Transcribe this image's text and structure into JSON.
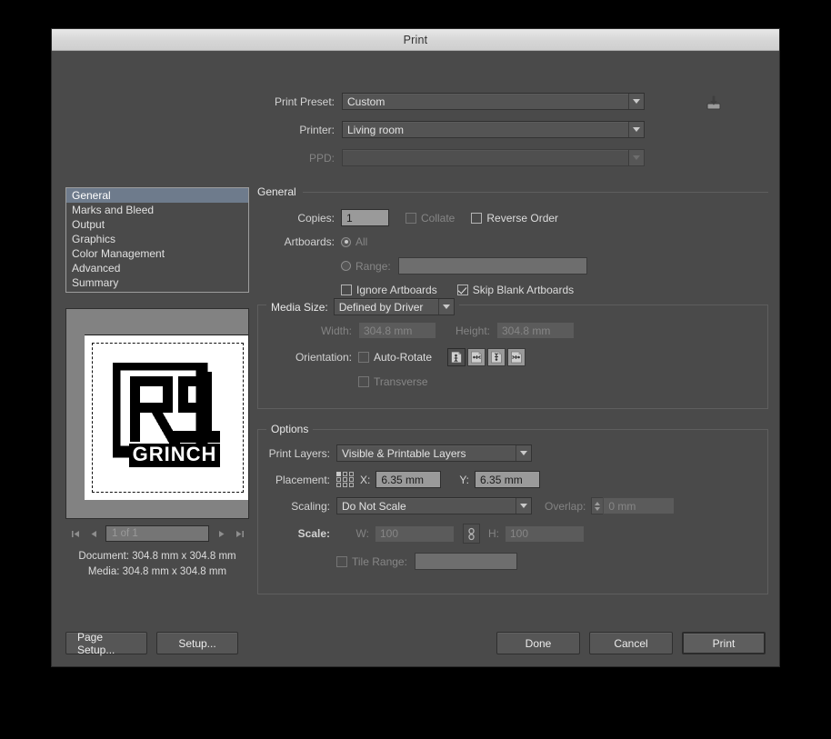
{
  "window": {
    "title": "Print"
  },
  "top": {
    "preset_label": "Print Preset:",
    "preset_value": "Custom",
    "printer_label": "Printer:",
    "printer_value": "Living room",
    "ppd_label": "PPD:",
    "ppd_value": "",
    "save_preset_icon": "save-to-disk-icon"
  },
  "nav": {
    "items": [
      {
        "label": "General",
        "active": true
      },
      {
        "label": "Marks and Bleed",
        "active": false
      },
      {
        "label": "Output",
        "active": false
      },
      {
        "label": "Graphics",
        "active": false
      },
      {
        "label": "Color Management",
        "active": false
      },
      {
        "label": "Advanced",
        "active": false
      },
      {
        "label": "Summary",
        "active": false
      }
    ]
  },
  "preview": {
    "page_indicator": "1 of 1",
    "first_icon": "first-page-icon",
    "prev_icon": "previous-page-icon",
    "next_icon": "next-page-icon",
    "last_icon": "last-page-icon",
    "document_label": "Document:",
    "document_value": "304.8 mm x 304.8 mm",
    "media_label": "Media:",
    "media_value": "304.8 mm x 304.8 mm",
    "artwork_alt": "RPI GRINCH logo"
  },
  "general": {
    "section_title": "General",
    "copies_label": "Copies:",
    "copies_value": "1",
    "collate_label": "Collate",
    "collate_checked": false,
    "reverse_order_label": "Reverse Order",
    "reverse_order_checked": false,
    "artboards_label": "Artboards:",
    "all_label": "All",
    "all_selected": true,
    "range_label": "Range:",
    "range_value": "",
    "ignore_artboards_label": "Ignore Artboards",
    "ignore_artboards_checked": false,
    "skip_blank_label": "Skip Blank Artboards",
    "skip_blank_checked": true
  },
  "media": {
    "legend_label": "Media Size:",
    "size_value": "Defined by Driver",
    "width_label": "Width:",
    "width_value": "304.8 mm",
    "height_label": "Height:",
    "height_value": "304.8 mm",
    "orientation_label": "Orientation:",
    "auto_rotate_label": "Auto-Rotate",
    "auto_rotate_checked": false,
    "orientation_buttons": [
      {
        "name": "portrait-up-icon",
        "selected": true
      },
      {
        "name": "landscape-left-icon",
        "selected": false
      },
      {
        "name": "portrait-down-icon",
        "selected": false
      },
      {
        "name": "landscape-right-icon",
        "selected": false
      }
    ],
    "transverse_label": "Transverse",
    "transverse_checked": false
  },
  "options": {
    "legend_label": "Options",
    "print_layers_label": "Print Layers:",
    "print_layers_value": "Visible & Printable Layers",
    "placement_label": "Placement:",
    "placement_anchor_icon": "placement-anchor-grid-icon",
    "x_label": "X:",
    "x_value": "6.35 mm",
    "y_label": "Y:",
    "y_value": "6.35 mm",
    "scaling_label": "Scaling:",
    "scaling_value": "Do Not Scale",
    "overlap_label": "Overlap:",
    "overlap_value": "0 mm",
    "scale_label": "Scale:",
    "w_label": "W:",
    "w_value": "100",
    "link_icon": "chain-link-icon",
    "h_label": "H:",
    "h_value": "100",
    "tile_range_label": "Tile Range:",
    "tile_range_value": "",
    "tile_range_checked": false
  },
  "footer": {
    "page_setup": "Page Setup...",
    "setup": "Setup...",
    "done": "Done",
    "cancel": "Cancel",
    "print": "Print"
  },
  "colors": {
    "dialog_bg": "#4a4a4a",
    "titlebar": "#d6d6d6",
    "selection": "#6e7b8c",
    "field_bg": "#9a9a9a",
    "text": "#dcdcdc"
  }
}
